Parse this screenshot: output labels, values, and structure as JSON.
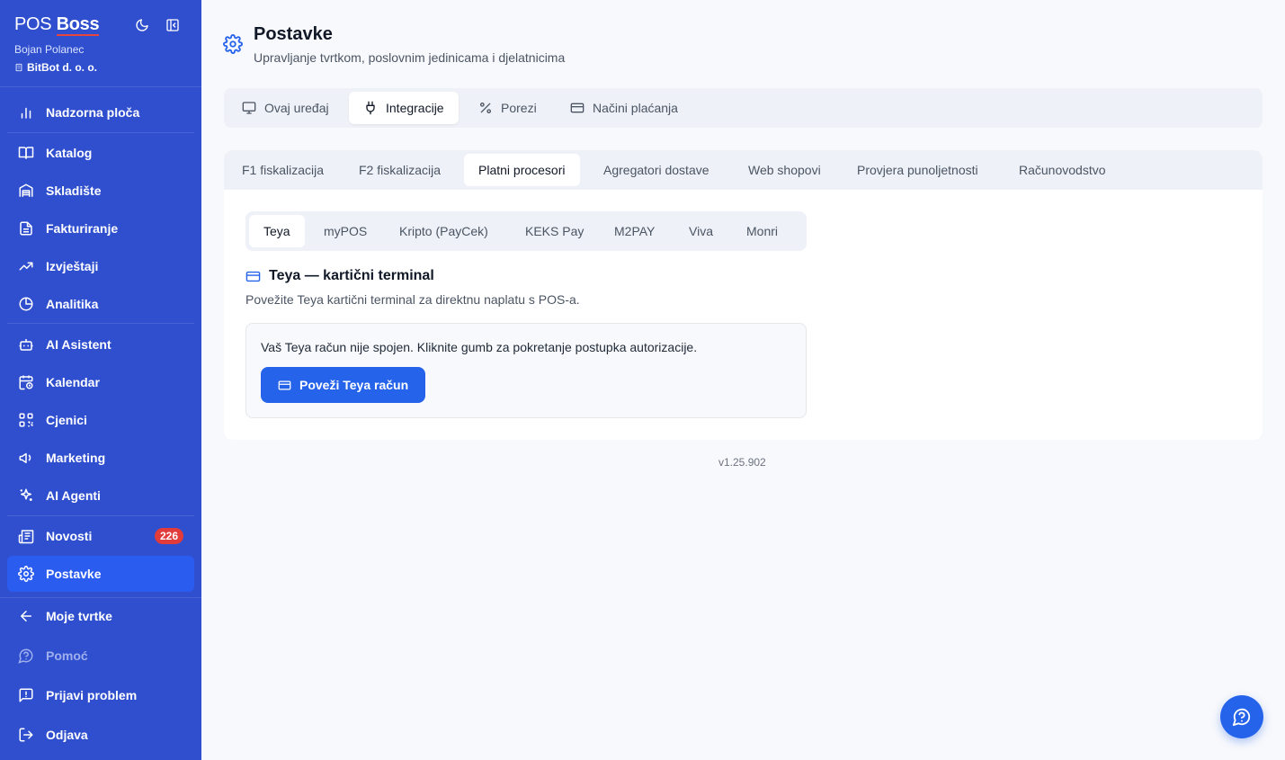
{
  "brand": {
    "pos": "POS",
    "boss": "Boss"
  },
  "user": {
    "name": "Bojan Polanec",
    "company": "BitBot d. o. o."
  },
  "sidebar": {
    "items": [
      {
        "label": "Nadzorna ploča",
        "icon": "bar-chart-icon"
      },
      {
        "label": "Katalog",
        "icon": "book-icon"
      },
      {
        "label": "Skladište",
        "icon": "warehouse-icon"
      },
      {
        "label": "Fakturiranje",
        "icon": "invoice-icon"
      },
      {
        "label": "Izvještaji",
        "icon": "trending-up-icon"
      },
      {
        "label": "Analitika",
        "icon": "pie-chart-icon"
      },
      {
        "label": "AI Asistent",
        "icon": "bot-icon"
      },
      {
        "label": "Kalendar",
        "icon": "calendar-clock-icon"
      },
      {
        "label": "Cjenici",
        "icon": "qr-code-icon"
      },
      {
        "label": "Marketing",
        "icon": "megaphone-icon"
      },
      {
        "label": "AI Agenti",
        "icon": "sparkles-icon"
      },
      {
        "label": "Novosti",
        "icon": "newspaper-icon",
        "badge": "226"
      },
      {
        "label": "Postavke",
        "icon": "gear-icon",
        "active": true
      },
      {
        "label": "Moje tvrtke",
        "icon": "arrow-left-icon"
      },
      {
        "label": "Pomoć",
        "icon": "help-circle-icon",
        "muted": true
      },
      {
        "label": "Prijavi problem",
        "icon": "message-alert-icon"
      },
      {
        "label": "Odjava",
        "icon": "logout-icon"
      }
    ]
  },
  "page": {
    "title": "Postavke",
    "subtitle": "Upravljanje tvrtkom, poslovnim jedinicama i djelatnicima"
  },
  "tabs_main": [
    {
      "label": "Ovaj uređaj",
      "icon": "monitor-icon"
    },
    {
      "label": "Integracije",
      "icon": "plug-icon",
      "active": true
    },
    {
      "label": "Porezi",
      "icon": "percent-icon"
    },
    {
      "label": "Načini plaćanja",
      "icon": "credit-card-icon"
    }
  ],
  "tabs_integrations": [
    {
      "label": "F1 fiskalizacija"
    },
    {
      "label": "F2 fiskalizacija"
    },
    {
      "label": "Platni procesori",
      "active": true
    },
    {
      "label": "Agregatori dostave"
    },
    {
      "label": "Web shopovi"
    },
    {
      "label": "Provjera punoljetnosti"
    },
    {
      "label": "Računovodstvo"
    }
  ],
  "tabs_processors": [
    {
      "label": "Teya",
      "active": true
    },
    {
      "label": "myPOS"
    },
    {
      "label": "Kripto (PayCek)"
    },
    {
      "label": "KEKS Pay"
    },
    {
      "label": "M2PAY"
    },
    {
      "label": "Viva"
    },
    {
      "label": "Monri"
    }
  ],
  "section": {
    "title": "Teya — kartični terminal",
    "description": "Povežite Teya kartični terminal za direktnu naplatu s POS-a.",
    "notice": "Vaš Teya račun nije spojen. Kliknite gumb za pokretanje postupka autorizacije.",
    "button": "Poveži Teya račun"
  },
  "version": "v1.25.902",
  "colors": {
    "sidebar": "#2f4fcf",
    "accent": "#2563eb",
    "badge": "#e23b3b"
  }
}
